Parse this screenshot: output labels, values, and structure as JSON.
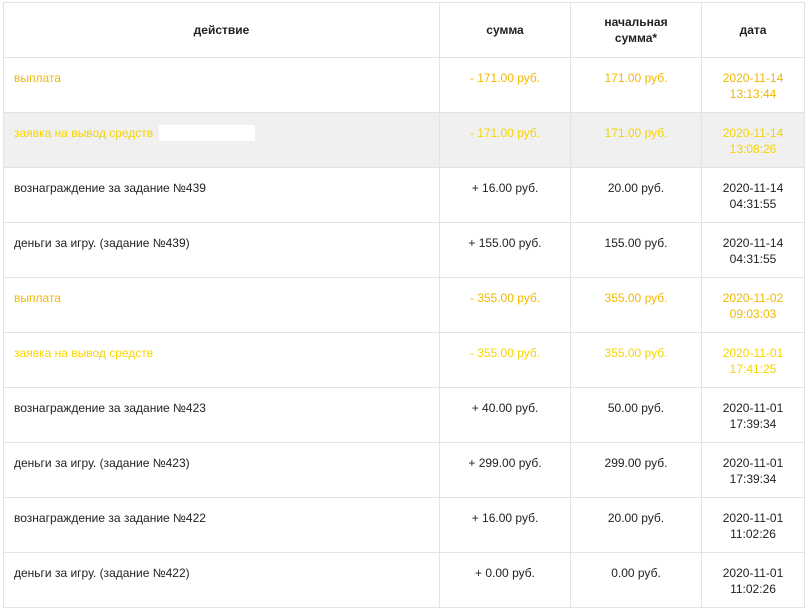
{
  "table": {
    "headers": {
      "action": "действие",
      "amount": "сумма",
      "initial_line1": "начальная",
      "initial_line2": "сумма*",
      "date": "дата"
    },
    "rows": [
      {
        "action": "выплата",
        "amount": "- 171.00 руб.",
        "initial": "171.00 руб.",
        "date": "2020-11-14",
        "time": "13:13:44",
        "status_color": "#f0b800"
      },
      {
        "action": "заявка на вывод средств",
        "amount": "- 171.00 руб.",
        "initial": "171.00 руб.",
        "date": "2020-11-14",
        "time": "13:08:26",
        "status_color": "#f6d400"
      },
      {
        "action": "вознаграждение за задание №439",
        "amount": "+ 16.00 руб.",
        "initial": "20.00 руб.",
        "date": "2020-11-14",
        "time": "04:31:55",
        "status_color": "#222222"
      },
      {
        "action": "деньги за игру. (задание №439)",
        "amount": "+ 155.00 руб.",
        "initial": "155.00 руб.",
        "date": "2020-11-14",
        "time": "04:31:55",
        "status_color": "#222222"
      },
      {
        "action": "выплата",
        "amount": "- 355.00 руб.",
        "initial": "355.00 руб.",
        "date": "2020-11-02",
        "time": "09:03:03",
        "status_color": "#f0b800"
      },
      {
        "action": "заявка на вывод средств",
        "amount": "- 355.00 руб.",
        "initial": "355.00 руб.",
        "date": "2020-11-01",
        "time": "17:41:25",
        "status_color": "#f6d400"
      },
      {
        "action": "вознаграждение за задание №423",
        "amount": "+ 40.00 руб.",
        "initial": "50.00 руб.",
        "date": "2020-11-01",
        "time": "17:39:34",
        "status_color": "#222222"
      },
      {
        "action": "деньги за игру. (задание №423)",
        "amount": "+ 299.00 руб.",
        "initial": "299.00 руб.",
        "date": "2020-11-01",
        "time": "17:39:34",
        "status_color": "#222222"
      },
      {
        "action": "вознаграждение за задание №422",
        "amount": "+ 16.00 руб.",
        "initial": "20.00 руб.",
        "date": "2020-11-01",
        "time": "11:02:26",
        "status_color": "#222222"
      },
      {
        "action": "деньги за игру. (задание №422)",
        "amount": "+ 0.00 руб.",
        "initial": "0.00 руб.",
        "date": "2020-11-01",
        "time": "11:02:26",
        "status_color": "#222222"
      }
    ]
  },
  "colors": {
    "payout": "#f0b800",
    "withdraw_request": "#f6d400",
    "shaded_row_bg": "#f0f0f0",
    "border": "#e3e3e3"
  }
}
